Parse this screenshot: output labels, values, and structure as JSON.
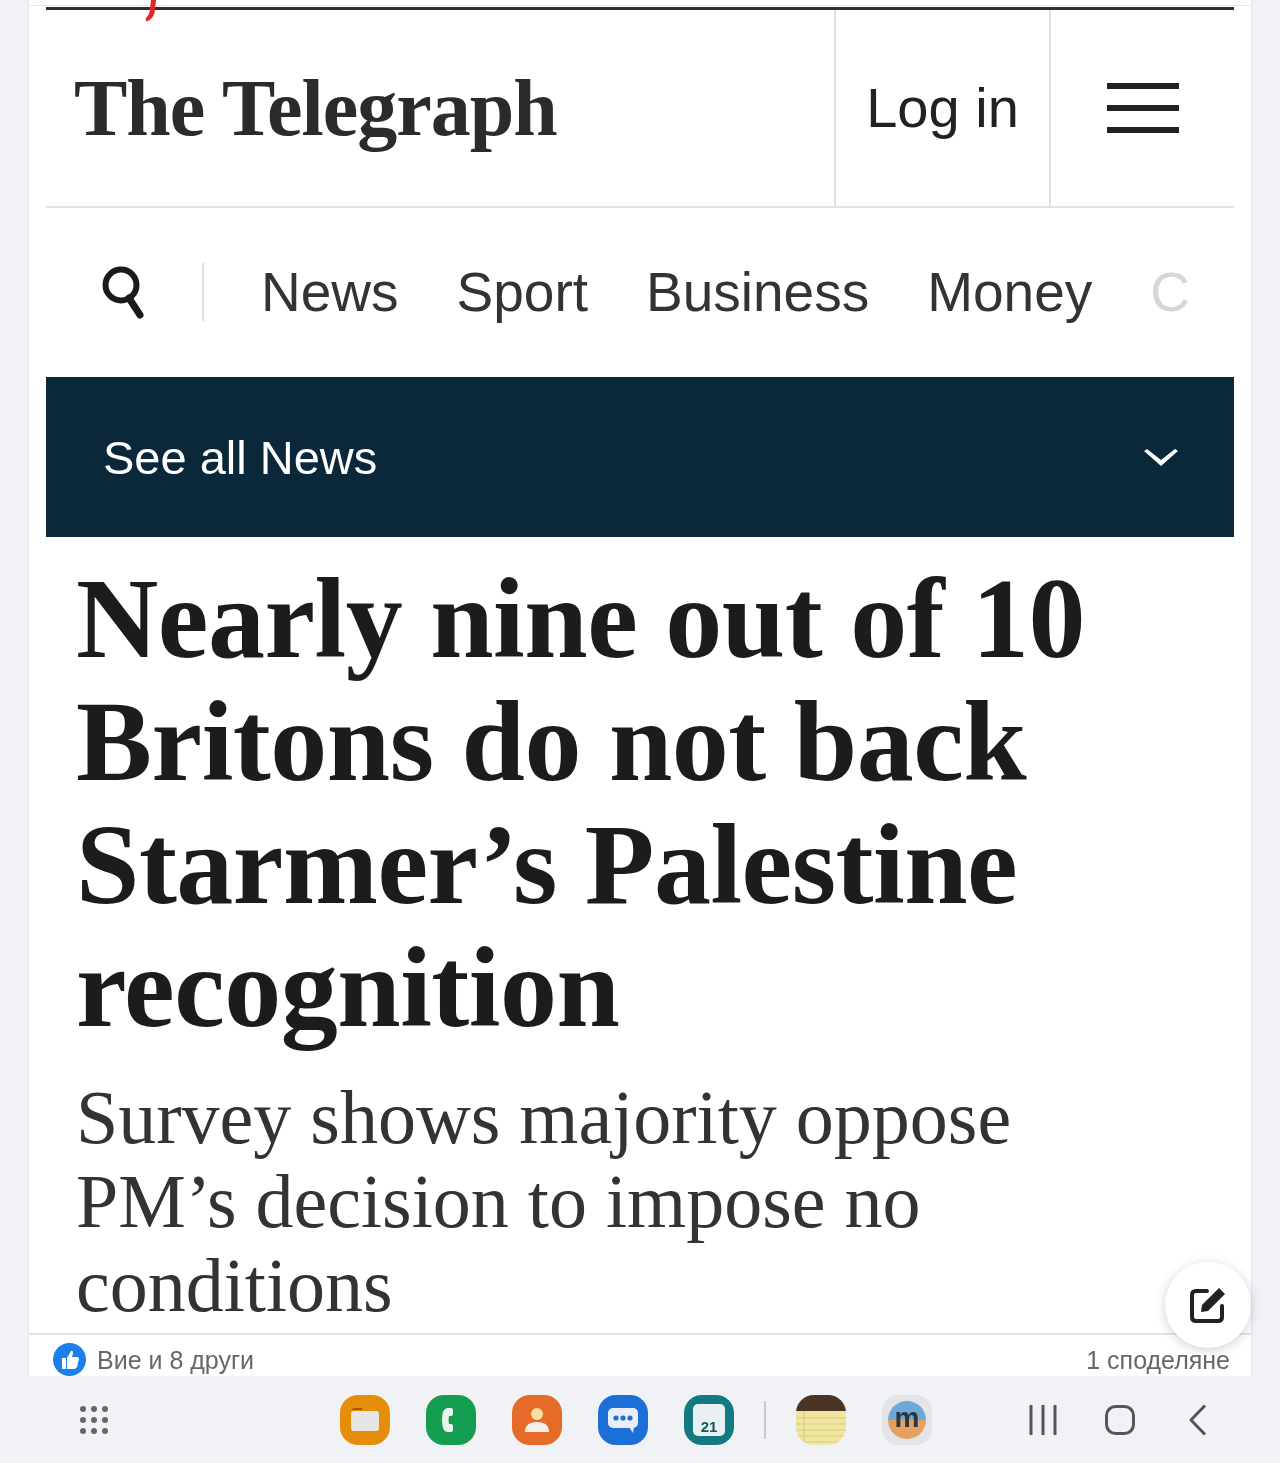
{
  "header": {
    "logo": "The Telegraph",
    "login": "Log in"
  },
  "nav": {
    "items": [
      {
        "label": "News",
        "faded": false
      },
      {
        "label": "Sport",
        "faded": false
      },
      {
        "label": "Business",
        "faded": false
      },
      {
        "label": "Money",
        "faded": false
      },
      {
        "label": "C",
        "faded": true
      }
    ]
  },
  "section_menu": {
    "label": "See all News",
    "expanded": false
  },
  "article": {
    "headline": "Nearly nine out of 10 Britons do not back Starmer’s Palestine recognition",
    "subheadline": "Survey shows majority oppose PM’s decision to impose no conditions"
  },
  "social_bar": {
    "reactions": "Вие и 8 други",
    "shares": "1 споделяне"
  },
  "dock": {
    "apps": [
      {
        "kind": "files"
      },
      {
        "kind": "phone"
      },
      {
        "kind": "contacts"
      },
      {
        "kind": "messages"
      },
      {
        "kind": "calendar",
        "label": "21"
      },
      {
        "kind": "divider"
      },
      {
        "kind": "notes"
      },
      {
        "kind": "letter",
        "label": "m"
      }
    ]
  }
}
